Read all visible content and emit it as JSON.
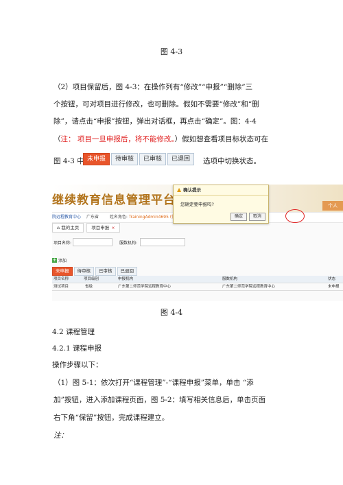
{
  "captions": {
    "fig_a": "图 4-3",
    "fig_b": "图 4-4"
  },
  "paragraph": {
    "line1": "（2）项目保留后，图 4-3：在操作列有“修改”“申报”“删除”三",
    "line2": "个按钮，可对项目进行修改，也可删除。假如不需要“修改”和“删",
    "line3": "除”，请点击“申报”按钮，弹出对话框，再点击“确定”。图：4-4",
    "line4_open": "（",
    "line4_note": "注：  项目一旦申报后，将不能修改。",
    "line4_rest": "）假如想查看项目标状态可在",
    "line5_start": "图 4-3 中",
    "line5_end": "选项中切换状态。"
  },
  "inline_tabs": [
    "未申报",
    "待审核",
    "已审核",
    "已退回"
  ],
  "screenshot": {
    "banner_title": "继续教育信息管理平台",
    "banner_corner": "个人",
    "info_org_label": "院远程教育中心",
    "info_region": "广东省",
    "info_role_label": "姓名角色:",
    "info_user": "TrainingAdmin4695 (修改",
    "subtabs": [
      "我的主页",
      "项目申报"
    ],
    "close_mark": "×",
    "search_labels": [
      "项目名称:",
      "服数机构:"
    ],
    "add_label": "添加",
    "add_icon_glyph": "+",
    "status_tabs": [
      "未申报",
      "待审核",
      "已审核",
      "已退回"
    ],
    "table_headers": [
      "项目名称",
      "项目级别",
      "申报机构",
      "服数机构",
      "状态"
    ],
    "table_rows": [
      [
        "测试项目",
        "省级",
        "广东第二师范学院远程教育中心",
        "广东第二师范学院远程教育中心",
        "未申报"
      ]
    ],
    "dialog": {
      "title": "确认提示",
      "message": "您确定要申报吗?",
      "ok": "确定",
      "cancel": "取消"
    }
  },
  "section": {
    "h1": "4.2 课程管理",
    "h2": "4.2.1 课程申报",
    "intro": "操作步骤以下：",
    "step1_line1": "（1）图 5-1：依次打开“课程管理”-“课程申报”菜单，单击 “添",
    "step1_line2": "加”按钮，进入添加课程页面，图 5-2：填写相关信息后，单击页面",
    "step1_line3": "右下角“保留”按钮，完成课程建立。",
    "note": "注："
  }
}
